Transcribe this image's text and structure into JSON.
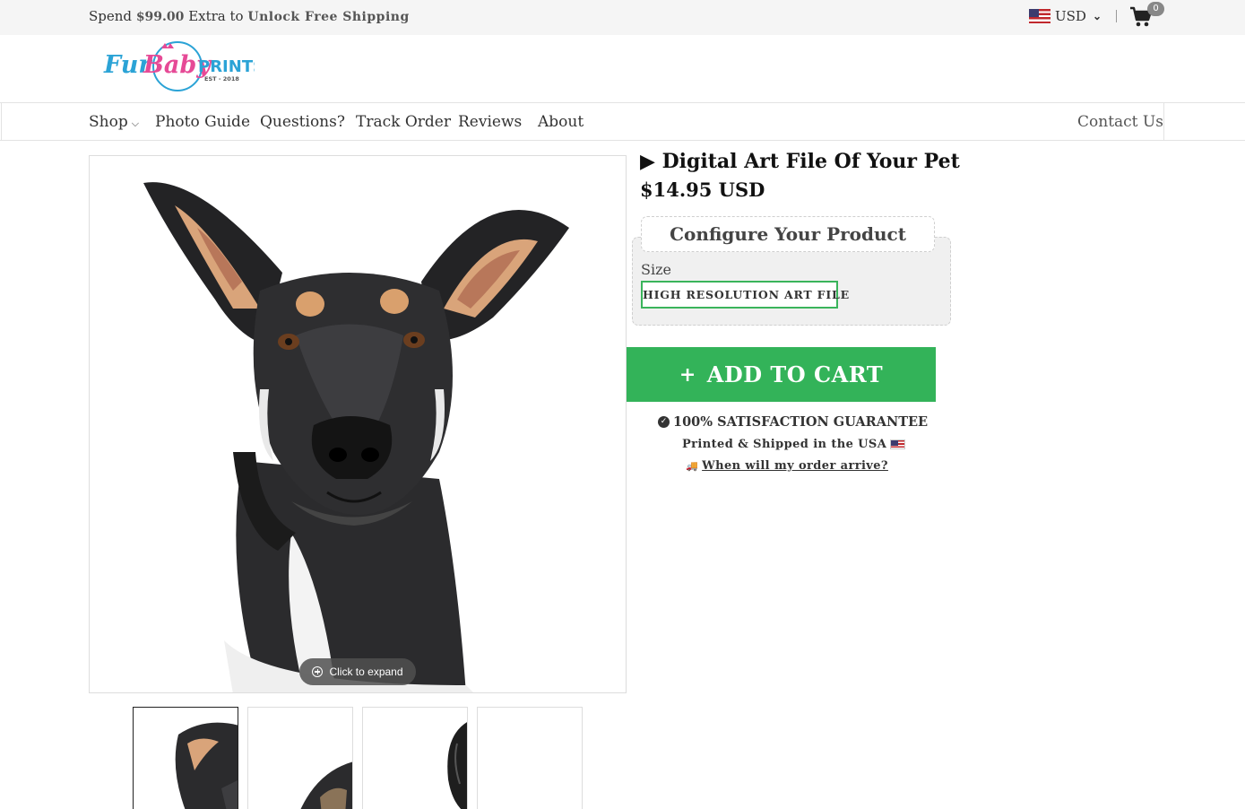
{
  "topbar": {
    "promo_prefix": "Spend",
    "promo_amount": "$99.00",
    "promo_middle": "Extra to",
    "promo_cta": "Unlock Free Shipping",
    "currency": "USD",
    "cart_count": "0"
  },
  "logo": {
    "brand": "FurBaby PRINTS",
    "tagline": "EST - 2018"
  },
  "nav": {
    "items": [
      {
        "label": "Shop"
      },
      {
        "label": "Photo Guide"
      },
      {
        "label": "Questions?"
      },
      {
        "label": "Track Order"
      },
      {
        "label": "Reviews"
      },
      {
        "label": "About"
      }
    ],
    "contact": "Contact Us"
  },
  "gallery": {
    "expand_label": "Click to expand",
    "thumbnail_count": 4,
    "active_thumbnail": 1
  },
  "product": {
    "title": "▶ Digital Art File Of Your Pet",
    "price": "$14.95 USD",
    "configure_title": "Configure Your Product",
    "size_label": "Size",
    "size_option": "HIGH RESOLUTION ART FILE",
    "add_to_cart": "ADD TO CART",
    "guarantee": "100% SATISFACTION GUARANTEE",
    "shipped": "Printed & Shipped in the USA",
    "arrival_link": "When will my order arrive?"
  },
  "colors": {
    "accent_green": "#33b359",
    "topbar_bg": "#f5f5f5",
    "config_bg": "#f0f0f0"
  }
}
